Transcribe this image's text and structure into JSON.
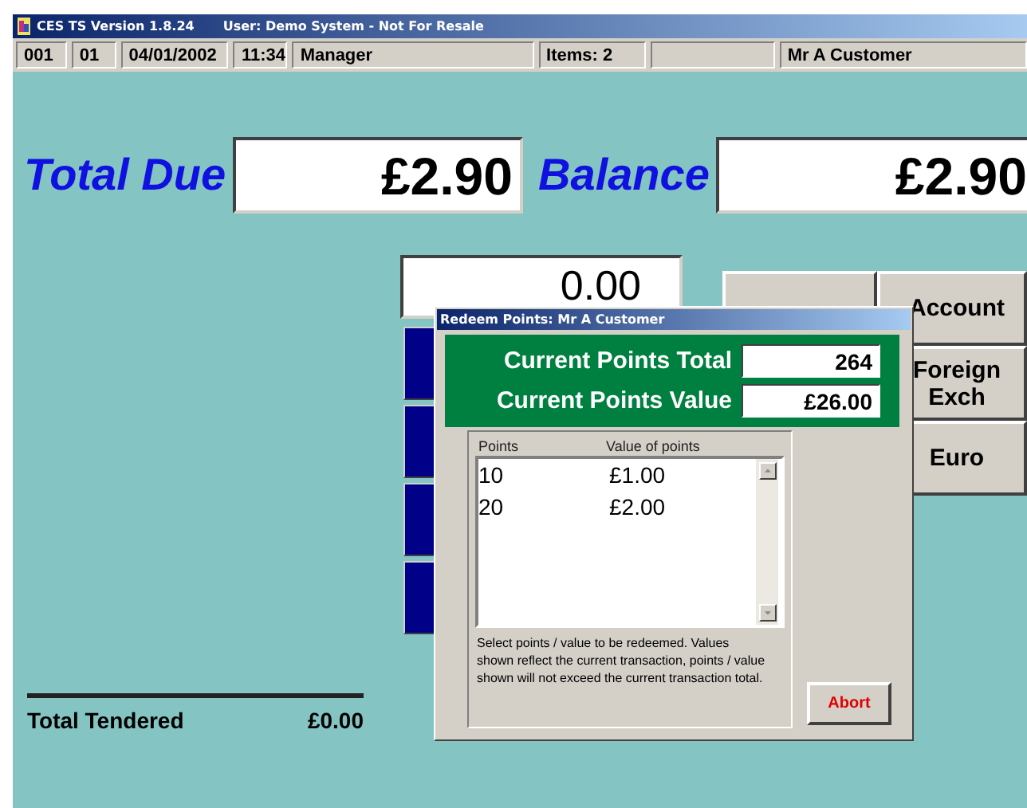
{
  "window": {
    "title": "CES TS Version 1.8.24",
    "user": "User: Demo System - Not For Resale"
  },
  "status_bar": [
    {
      "kind": "text",
      "text": "001"
    },
    {
      "kind": "text",
      "text": "01"
    },
    {
      "kind": "text",
      "text": "04/01/2002"
    },
    {
      "kind": "text",
      "text": "11:34"
    },
    {
      "kind": "text",
      "text": "Manager"
    },
    {
      "kind": "text",
      "text": "Items: 2"
    },
    {
      "kind": "blank"
    },
    {
      "kind": "text",
      "text": "Mr A Customer"
    }
  ],
  "totals": [
    {
      "label": "Total Due",
      "value": "£2.90"
    },
    {
      "label": "Balance",
      "value": "£2.90"
    }
  ],
  "tender_amount": "0.00",
  "payment_buttons": [
    "Account",
    "Foreign Exch",
    "Euro"
  ],
  "total_tendered": {
    "label": "Total Tendered",
    "value": "£0.00"
  },
  "dialog": {
    "title": "Redeem Points: Mr A Customer",
    "fields": [
      {
        "label": "Current Points Total",
        "value": "264"
      },
      {
        "label": "Current Points Value",
        "value": "£26.00"
      }
    ],
    "list": {
      "columns": [
        "Points",
        "Value of points"
      ],
      "rows": [
        [
          "10",
          "£1.00"
        ],
        [
          "20",
          "£2.00"
        ]
      ]
    },
    "help": "Select points / value to be redeemed. Values shown reflect the current transaction, points / value shown will not exceed the current transaction total.",
    "abort_button": "Abort"
  }
}
